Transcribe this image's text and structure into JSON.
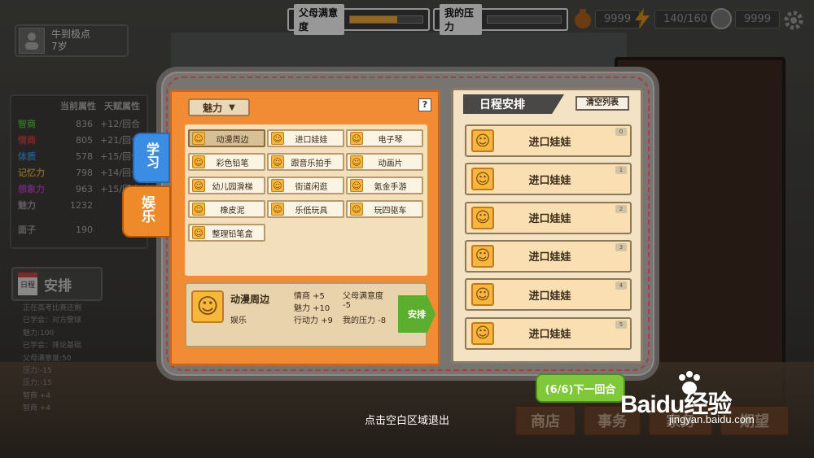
{
  "topbar": {
    "parent_satisfaction_label": "父母满意度",
    "parent_satisfaction_level": 0.65,
    "pressure_label": "我的压力",
    "pressure_level": 0.0,
    "money": "9999",
    "energy": "140/160",
    "coins": "9999"
  },
  "profile": {
    "name": "牛到极点",
    "age": "7岁"
  },
  "attributes": {
    "header_current": "当前属性",
    "header_talent": "天赋属性",
    "rows": [
      {
        "name": "智商",
        "value": "836",
        "talent": "+12/回合",
        "color": "#4caf3c"
      },
      {
        "name": "情商",
        "value": "805",
        "talent": "+21/回合",
        "color": "#d23c3c"
      },
      {
        "name": "体质",
        "value": "578",
        "talent": "+15/回合",
        "color": "#3c8ed2"
      },
      {
        "name": "记忆力",
        "value": "798",
        "talent": "+14/回合",
        "color": "#c8a030"
      },
      {
        "name": "想象力",
        "value": "963",
        "talent": "+15/回合",
        "color": "#b040b8"
      },
      {
        "name": "魅力",
        "value": "1232",
        "talent": "",
        "color": "#999"
      },
      {
        "name": "面子",
        "value": "190",
        "talent": "",
        "color": "#999"
      }
    ]
  },
  "schedule_button": {
    "calendar": "日程",
    "label": "安排"
  },
  "log": [
    "正在高考比赛还剩",
    "已学会：对方警球",
    "魅力:100",
    "已学会：排论基础",
    "父母满意度:50",
    "压力:-15",
    "压力:-15",
    "智商 +4",
    "智商 +4"
  ],
  "bottom_buttons": [
    "商店",
    "事务",
    "家务",
    "期望"
  ],
  "tabs": {
    "study": "学习",
    "fun": "娱乐"
  },
  "left_panel": {
    "dropdown": "魅力",
    "dropdown_arrow": "▼",
    "help": "?",
    "items": [
      "动漫周边",
      "进口娃娃",
      "电子琴",
      "彩色铅笔",
      "跟音乐拍手",
      "动画片",
      "幼儿园滑梯",
      "街道闲逛",
      "氪金手游",
      "橡皮泥",
      "乐低玩具",
      "玩四驱车",
      "整理铅笔盒"
    ],
    "selected_index": 0
  },
  "detail": {
    "name": "动漫周边",
    "category": "娱乐",
    "effects": [
      "情商 +5",
      "魅力 +10",
      "行动力 +9",
      "父母满意度",
      "-5",
      "我的压力 -8"
    ],
    "arrange_label": "安排"
  },
  "schedule": {
    "title": "日程安排",
    "clear_label": "清空列表",
    "slots": [
      {
        "label": "进口娃娃",
        "index": "0"
      },
      {
        "label": "进口娃娃",
        "index": "1"
      },
      {
        "label": "进口娃娃",
        "index": "2"
      },
      {
        "label": "进口娃娃",
        "index": "3"
      },
      {
        "label": "进口娃娃",
        "index": "4"
      },
      {
        "label": "进口娃娃",
        "index": "5"
      }
    ]
  },
  "next_round": "(6/6)下一回合",
  "exit_hint": "点击空白区域退出",
  "watermark": {
    "brand": "Baidu经验",
    "url": "jingyan.baidu.com"
  }
}
